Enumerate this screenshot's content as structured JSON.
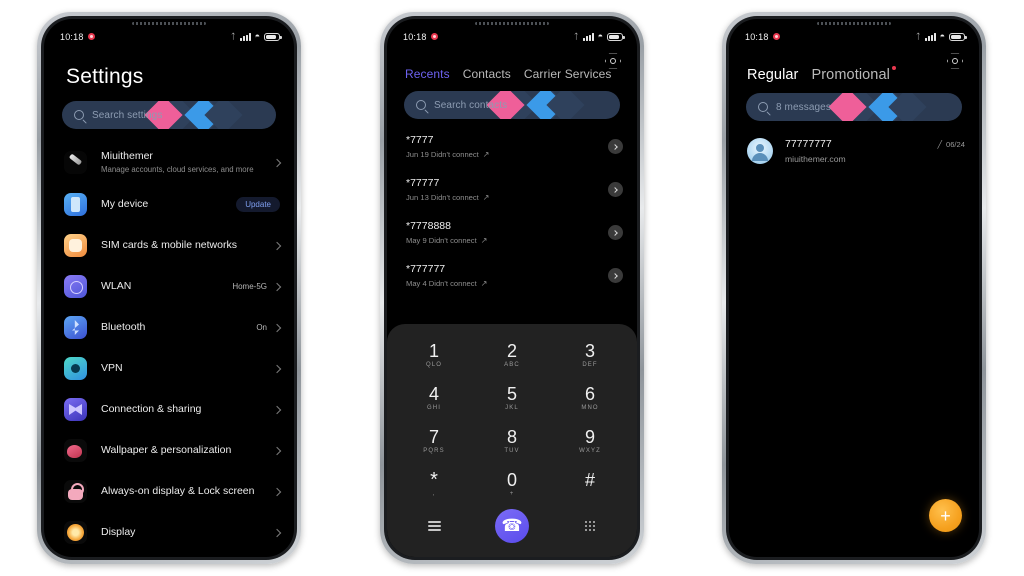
{
  "status_bar": {
    "time": "10:18",
    "icons": [
      "notification-dot",
      "bluetooth-icon",
      "signal-icon",
      "wifi-icon",
      "battery-icon"
    ]
  },
  "colors": {
    "accent_purple": "#6d62f0",
    "accent_orange": "#f6a11f",
    "search_bg": "#2b3a52",
    "diamond_pink": "#ef5f99",
    "diamond_blue": "#3b9ae8",
    "screen_bg": "#000000"
  },
  "settings_phone": {
    "title": "Settings",
    "search": {
      "placeholder": "Search settings"
    },
    "items": [
      {
        "label": "Miuithemer",
        "sub": "Manage accounts, cloud services, and more",
        "value": "",
        "icon": "account-icon",
        "chevron": true,
        "badge": ""
      },
      {
        "label": "My device",
        "sub": "",
        "value": "",
        "icon": "device-icon",
        "chevron": false,
        "badge": "Update"
      },
      {
        "label": "SIM cards & mobile networks",
        "sub": "",
        "value": "",
        "icon": "sim-icon",
        "chevron": true,
        "badge": ""
      },
      {
        "label": "WLAN",
        "sub": "",
        "value": "Home-5G",
        "icon": "wlan-icon",
        "chevron": true,
        "badge": ""
      },
      {
        "label": "Bluetooth",
        "sub": "",
        "value": "On",
        "icon": "bluetooth-icon",
        "chevron": true,
        "badge": ""
      },
      {
        "label": "VPN",
        "sub": "",
        "value": "",
        "icon": "vpn-icon",
        "chevron": true,
        "badge": ""
      },
      {
        "label": "Connection & sharing",
        "sub": "",
        "value": "",
        "icon": "connection-icon",
        "chevron": true,
        "badge": ""
      },
      {
        "label": "Wallpaper & personalization",
        "sub": "",
        "value": "",
        "icon": "wallpaper-icon",
        "chevron": true,
        "badge": ""
      },
      {
        "label": "Always-on display & Lock screen",
        "sub": "",
        "value": "",
        "icon": "lock-icon",
        "chevron": true,
        "badge": ""
      },
      {
        "label": "Display",
        "sub": "",
        "value": "",
        "icon": "display-icon",
        "chevron": true,
        "badge": ""
      }
    ]
  },
  "dialer_phone": {
    "settings_icon": "gear-icon",
    "tabs": [
      {
        "label": "Recents",
        "active": true
      },
      {
        "label": "Contacts",
        "active": false
      },
      {
        "label": "Carrier Services",
        "active": false
      }
    ],
    "search": {
      "placeholder": "Search contacts"
    },
    "calls": [
      {
        "number": "*7777",
        "meta": "Jun 19 Didn't connect",
        "direction": "outgoing"
      },
      {
        "number": "*77777",
        "meta": "Jun 13 Didn't connect",
        "direction": "outgoing"
      },
      {
        "number": "*7778888",
        "meta": "May 9 Didn't connect",
        "direction": "outgoing"
      },
      {
        "number": "*777777",
        "meta": "May 4 Didn't connect",
        "direction": "outgoing"
      }
    ],
    "dialpad": {
      "keys": [
        {
          "digit": "1",
          "letters": "QLO"
        },
        {
          "digit": "2",
          "letters": "ABC"
        },
        {
          "digit": "3",
          "letters": "DEF"
        },
        {
          "digit": "4",
          "letters": "GHI"
        },
        {
          "digit": "5",
          "letters": "JKL"
        },
        {
          "digit": "6",
          "letters": "MNO"
        },
        {
          "digit": "7",
          "letters": "PQRS"
        },
        {
          "digit": "8",
          "letters": "TUV"
        },
        {
          "digit": "9",
          "letters": "WXYZ"
        },
        {
          "digit": "*",
          "letters": ","
        },
        {
          "digit": "0",
          "letters": "+"
        },
        {
          "digit": "#",
          "letters": ""
        }
      ],
      "actions": {
        "menu": "menu-icon",
        "call": "call-icon",
        "keypad": "keypad-icon"
      }
    }
  },
  "messages_phone": {
    "settings_icon": "gear-icon",
    "tabs": [
      {
        "label": "Regular",
        "active": true
      },
      {
        "label": "Promotional",
        "active": false,
        "dot": true
      }
    ],
    "search": {
      "placeholder": "8 messages"
    },
    "threads": [
      {
        "name": "77777777",
        "preview": "miuithemer.com",
        "date": "06/24"
      }
    ],
    "fab": {
      "label": "+"
    }
  }
}
